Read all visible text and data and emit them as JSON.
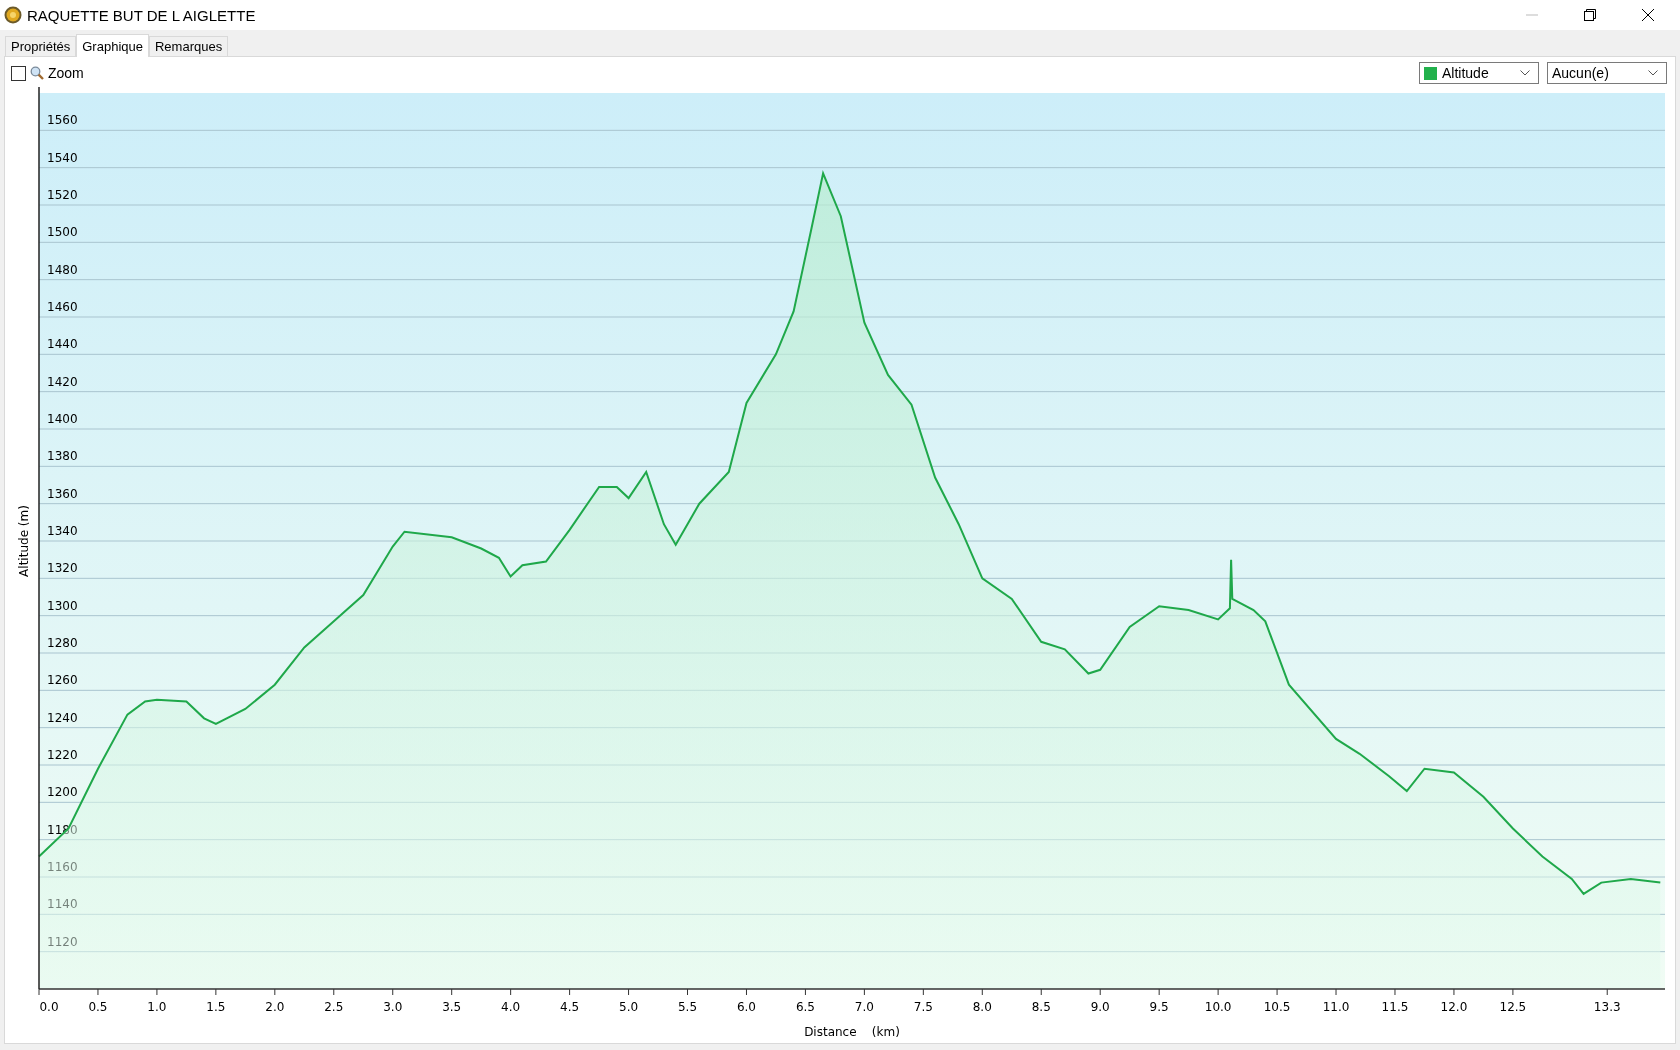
{
  "window": {
    "title": "RAQUETTE BUT DE L AIGLETTE"
  },
  "tabs": [
    {
      "label": "Propriétés",
      "selected": false
    },
    {
      "label": "Graphique",
      "selected": true
    },
    {
      "label": "Remarques",
      "selected": false
    }
  ],
  "toolbar": {
    "zoom": {
      "label": "Zoom",
      "checked": false
    },
    "series_select": {
      "color": "#22b14c"
    },
    "second_select": {
      "value": "Aucun(e)"
    }
  },
  "graph": {
    "chart_data": {
      "type": "area",
      "xlabel": "Distance    (km)",
      "ylabel": "Altitude (m)",
      "x": [
        0,
        0.25,
        0.5,
        0.75,
        0.9,
        1.0,
        1.25,
        1.4,
        1.5,
        1.75,
        2.0,
        2.25,
        2.5,
        2.75,
        3.0,
        3.1,
        3.5,
        3.75,
        3.9,
        4.0,
        4.1,
        4.3,
        4.5,
        4.75,
        4.9,
        5.0,
        5.15,
        5.3,
        5.4,
        5.6,
        5.85,
        6.0,
        6.25,
        6.4,
        6.55,
        6.65,
        6.8,
        7.0,
        7.2,
        7.4,
        7.6,
        7.8,
        8.0,
        8.25,
        8.5,
        8.7,
        8.9,
        9.0,
        9.25,
        9.5,
        9.75,
        10.0,
        10.1,
        10.11,
        10.12,
        10.3,
        10.4,
        10.6,
        11.0,
        11.2,
        11.45,
        11.6,
        11.75,
        12.0,
        12.25,
        12.5,
        12.75,
        13.0,
        13.1,
        13.25,
        13.5,
        13.75
      ],
      "series": [
        {
          "name": "Altitude",
          "color": "#1fa84a",
          "values": [
            1171,
            1186,
            1218,
            1247,
            1254,
            1255,
            1254,
            1245,
            1242,
            1250,
            1263,
            1283,
            1297,
            1311,
            1337,
            1345,
            1342,
            1336,
            1331,
            1321,
            1327,
            1329,
            1346,
            1369,
            1369,
            1363,
            1377,
            1349,
            1338,
            1360,
            1377,
            1414,
            1440,
            1463,
            1507,
            1537,
            1514,
            1457,
            1429,
            1413,
            1374,
            1349,
            1320,
            1309,
            1286,
            1282,
            1269,
            1271,
            1294,
            1305,
            1303,
            1298,
            1304,
            1330,
            1309,
            1303,
            1297,
            1263,
            1234,
            1226,
            1214,
            1206,
            1218,
            1216,
            1203,
            1186,
            1171,
            1159,
            1151,
            1157,
            1159,
            1157
          ]
        }
      ],
      "xlim": [
        0,
        13.79
      ],
      "ylim": [
        1100,
        1580
      ],
      "grid": true,
      "xticks": [
        {
          "value": 0,
          "label": "0.0"
        },
        0.5,
        {
          "value": 1,
          "label": "1.0"
        },
        1.5,
        {
          "value": 2,
          "label": "2.0"
        },
        2.5,
        {
          "value": 3,
          "label": "3.0"
        },
        3.5,
        {
          "value": 4,
          "label": "4.0"
        },
        4.5,
        {
          "value": 5,
          "label": "5.0"
        },
        5.5,
        {
          "value": 6,
          "label": "6.0"
        },
        6.5,
        {
          "value": 7,
          "label": "7.0"
        },
        7.5,
        {
          "value": 8,
          "label": "8.0"
        },
        8.5,
        {
          "value": 9,
          "label": "9.0"
        },
        9.5,
        {
          "value": 10,
          "label": "10.0"
        },
        10.5,
        {
          "value": 11,
          "label": "11.0"
        },
        11.5,
        {
          "value": 12,
          "label": "12.0"
        },
        12.5,
        13.3
      ],
      "yticks": [
        1120,
        1140,
        1160,
        1180,
        1200,
        1220,
        1240,
        1260,
        1280,
        1300,
        1320,
        1340,
        1360,
        1380,
        1400,
        1420,
        1440,
        1460,
        1480,
        1500,
        1520,
        1540,
        1560
      ]
    }
  }
}
